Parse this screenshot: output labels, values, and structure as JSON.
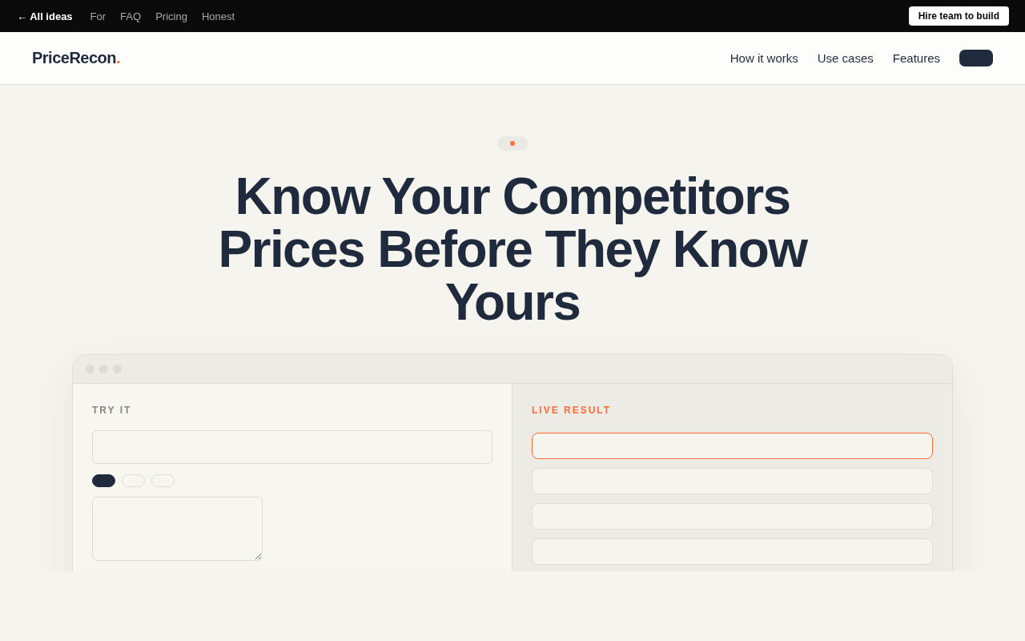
{
  "top_bar": {
    "back_link": "← All ideas",
    "links": [
      "For",
      "FAQ",
      "Pricing",
      "Honest"
    ],
    "cta": "Hire team to build"
  },
  "nav": {
    "logo": {
      "name": "PriceRecon",
      "accent": "."
    },
    "links": [
      "How it works",
      "Use cases",
      "Features"
    ]
  },
  "hero": {
    "headline": "Know Your Competitors Prices Before They Know Yours"
  },
  "demo": {
    "input_label": "TRY IT",
    "chips": [
      {
        "selected": true
      },
      {
        "selected": false
      },
      {
        "selected": false
      }
    ],
    "result_label": "LIVE RESULT",
    "results": [
      {
        "selected": true
      },
      {
        "selected": false
      },
      {
        "selected": false
      },
      {
        "selected": false
      }
    ]
  }
}
